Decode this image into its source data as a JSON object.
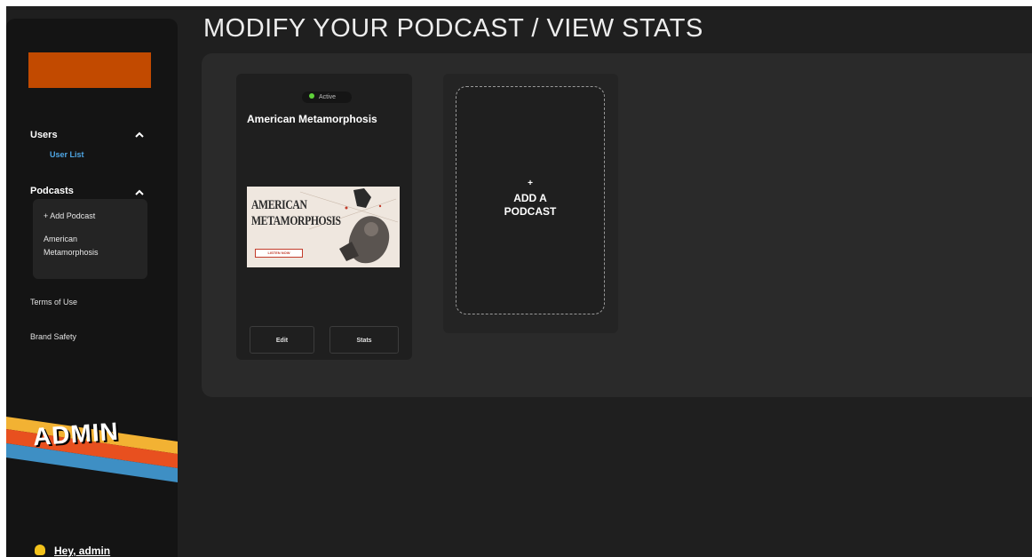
{
  "page": {
    "title": "MODIFY YOUR PODCAST / VIEW STATS"
  },
  "sidebar": {
    "sections": [
      {
        "label": "Users",
        "expanded": true,
        "children": [
          "User List"
        ]
      },
      {
        "label": "Podcasts",
        "expanded": true,
        "children": [
          "+ Add Podcast",
          "American Metamorphosis"
        ]
      }
    ],
    "submenu": {
      "add_podcast": "+ Add Podcast",
      "podcast_line1": "American",
      "podcast_line2": "Metamorphosis"
    },
    "users_label": "Users",
    "user_list_label": "User List",
    "podcasts_label": "Podcasts",
    "terms_label": "Terms of Use",
    "brand_safety_label": "Brand Safety",
    "banner_text": "ADMIN",
    "greeting": {
      "icon": "waving-hand-icon",
      "text": "Hey, admin"
    }
  },
  "podcast_card": {
    "status": "Active",
    "title": "American Metamorphosis",
    "cover": {
      "title_line1": "AMERICAN",
      "title_line2": "METAMORPHOSIS",
      "cta": "LISTEN NOW"
    },
    "edit_label": "Edit",
    "stats_label": "Stats"
  },
  "add_tile": {
    "plus": "+",
    "label_line1": "ADD A",
    "label_line2": "PODCAST"
  },
  "colors": {
    "accent_orange": "#c24a00",
    "link_blue": "#4fa7e6",
    "status_green": "#5fd13a",
    "background": "#1f1f1f",
    "sidebar": "#141414"
  }
}
